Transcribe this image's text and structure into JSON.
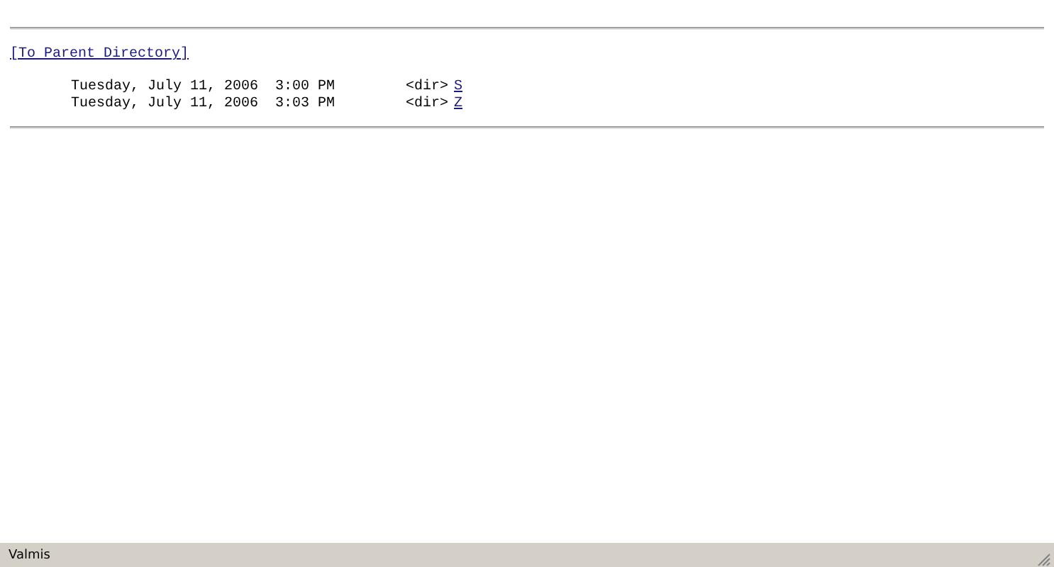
{
  "parent_link": "[To Parent Directory]",
  "entries": [
    {
      "date": "Tuesday, July 11, 2006  3:00 PM",
      "size": "<dir>",
      "name": "S"
    },
    {
      "date": "Tuesday, July 11, 2006  3:03 PM",
      "size": "<dir>",
      "name": "Z"
    }
  ],
  "status_bar": "Valmis"
}
